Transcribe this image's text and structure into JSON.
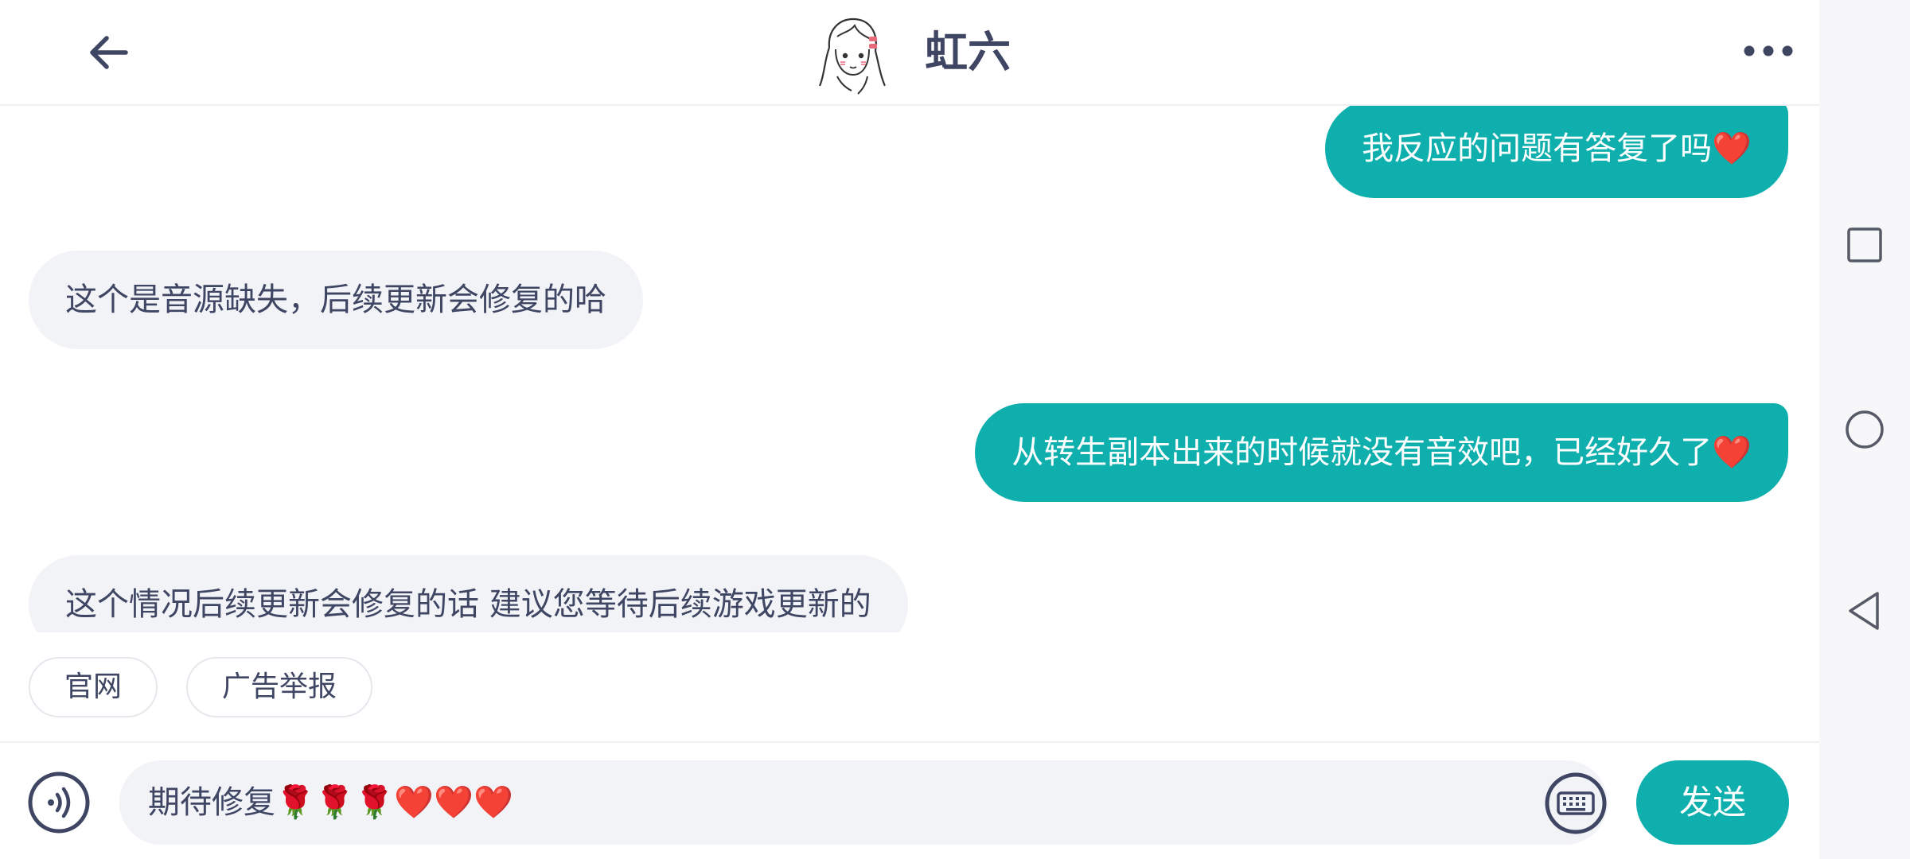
{
  "header": {
    "contact_name": "虹六"
  },
  "messages": [
    {
      "direction": "sent",
      "text": "我反应的问题有答复了吗❤️"
    },
    {
      "direction": "received",
      "text": "这个是音源缺失，后续更新会修复的哈"
    },
    {
      "direction": "sent",
      "text": "从转生副本出来的时候就没有音效吧，已经好久了❤️"
    },
    {
      "direction": "received",
      "text": "这个情况后续更新会修复的话 建议您等待后续游戏更新的"
    }
  ],
  "quick_links": [
    {
      "label": "官网"
    },
    {
      "label": "广告举报"
    }
  ],
  "composer": {
    "input_value": "期待修复🌹🌹🌹❤️❤️❤️",
    "send_label": "发送"
  },
  "icons": {
    "back": "arrow-left-icon",
    "more": "more-horizontal-icon",
    "voice": "voice-icon",
    "keyboard": "keyboard-icon",
    "recents": "square-icon",
    "home": "circle-icon",
    "nav_back": "triangle-back-icon"
  },
  "colors": {
    "accent": "#0eafad",
    "text": "#3f4663",
    "received_bubble": "#f1f3f7"
  }
}
